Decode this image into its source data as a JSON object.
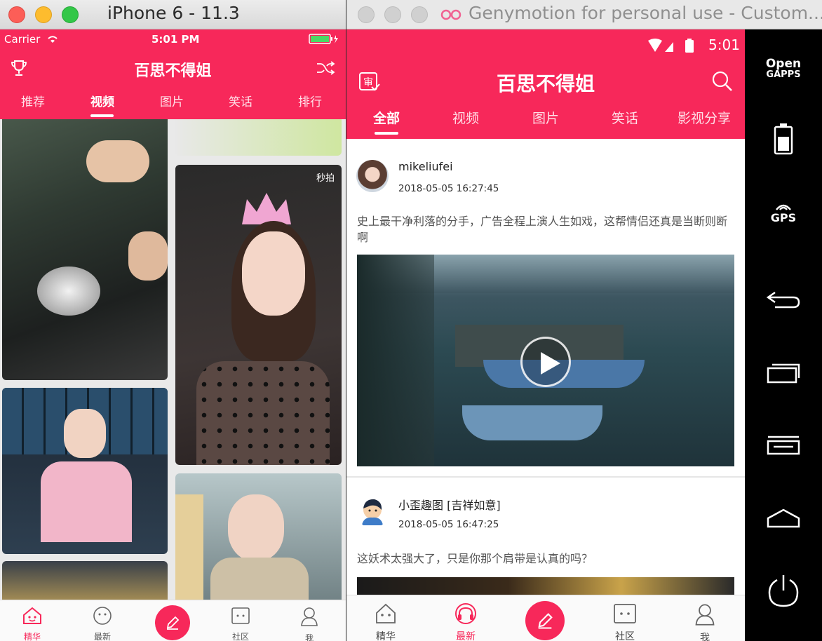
{
  "ios": {
    "window_title": "iPhone 6 - 11.3",
    "status": {
      "carrier": "Carrier",
      "time": "5:01 PM"
    },
    "nav_title": "百思不得姐",
    "tabs": [
      "推荐",
      "视频",
      "图片",
      "笑话",
      "排行"
    ],
    "active_tab": "视频",
    "card_badge": "秒拍",
    "tabbar": [
      "精华",
      "最新",
      "社区",
      "我"
    ]
  },
  "android": {
    "window_title": "Genymotion for personal use - Custom...",
    "status": {
      "time": "5:01"
    },
    "nav_title": "百思不得姐",
    "tabs": [
      "全部",
      "视频",
      "图片",
      "笑话",
      "影视分享"
    ],
    "active_tab": "全部",
    "posts": [
      {
        "name": "mikeliufei",
        "time": "2018-05-05 16:27:45",
        "text": "史上最干净利落的分手，广告全程上演人生如戏，这帮情侣还真是当断则断啊"
      },
      {
        "name": "小歪趣图 [吉祥如意]",
        "time": "2018-05-05 16:47:25",
        "text": "这妖术太强大了，只是你那个肩带是认真的吗？"
      }
    ],
    "tabbar": [
      "精华",
      "最新",
      "社区",
      "我"
    ],
    "active_tabbar": "最新",
    "sidebar": {
      "opengapps_line1": "Open",
      "opengapps_line2": "GAPPS",
      "gps": "GPS"
    }
  },
  "colors": {
    "brand": "#f7285a"
  }
}
